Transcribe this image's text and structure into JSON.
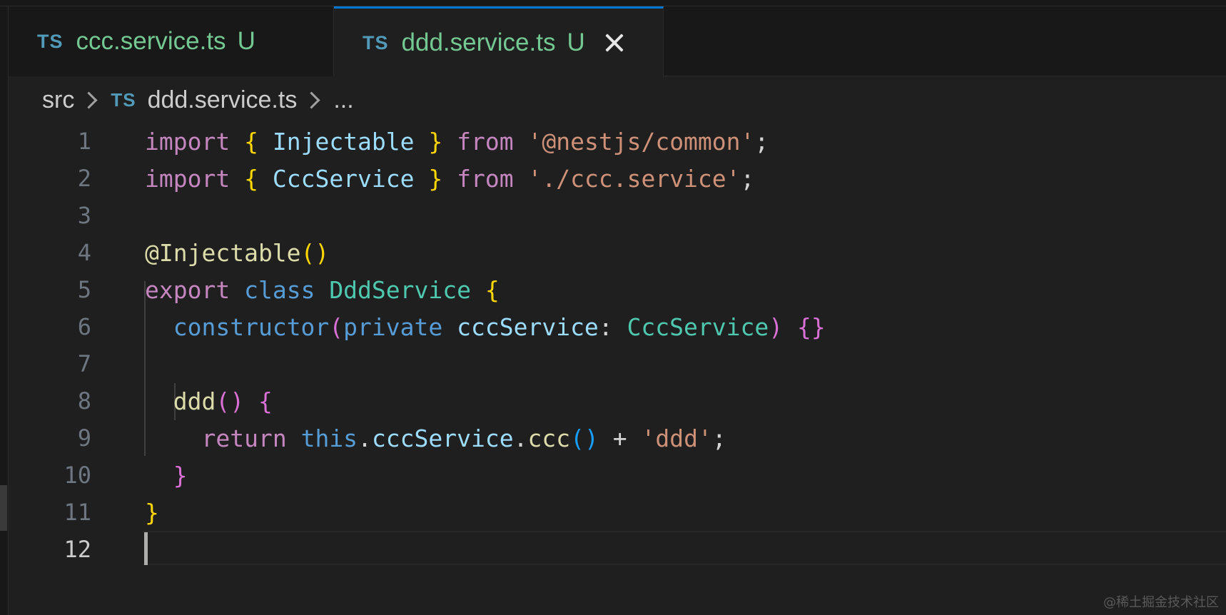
{
  "tabs": [
    {
      "lang_badge": "TS",
      "name": "ccc.service.ts",
      "status": "U",
      "active": false
    },
    {
      "lang_badge": "TS",
      "name": "ddd.service.ts",
      "status": "U",
      "active": true
    }
  ],
  "breadcrumb": {
    "folder": "src",
    "lang_badge": "TS",
    "file": "ddd.service.ts",
    "more": "..."
  },
  "editor": {
    "current_line": 12,
    "line_numbers": [
      "1",
      "2",
      "3",
      "4",
      "5",
      "6",
      "7",
      "8",
      "9",
      "10",
      "11",
      "12"
    ],
    "lines": [
      [
        [
          "kw",
          "import"
        ],
        [
          "punc",
          " "
        ],
        [
          "br1",
          "{"
        ],
        [
          "punc",
          " "
        ],
        [
          "ident",
          "Injectable"
        ],
        [
          "punc",
          " "
        ],
        [
          "br1",
          "}"
        ],
        [
          "punc",
          " "
        ],
        [
          "kw",
          "from"
        ],
        [
          "punc",
          " "
        ],
        [
          "str",
          "'@nestjs/common'"
        ],
        [
          "punc",
          ";"
        ]
      ],
      [
        [
          "kw",
          "import"
        ],
        [
          "punc",
          " "
        ],
        [
          "br1",
          "{"
        ],
        [
          "punc",
          " "
        ],
        [
          "ident",
          "CccService"
        ],
        [
          "punc",
          " "
        ],
        [
          "br1",
          "}"
        ],
        [
          "punc",
          " "
        ],
        [
          "kw",
          "from"
        ],
        [
          "punc",
          " "
        ],
        [
          "str",
          "'./ccc.service'"
        ],
        [
          "punc",
          ";"
        ]
      ],
      [],
      [
        [
          "func",
          "@Injectable"
        ],
        [
          "br1",
          "()"
        ]
      ],
      [
        [
          "kw",
          "export"
        ],
        [
          "punc",
          " "
        ],
        [
          "kw2",
          "class"
        ],
        [
          "punc",
          " "
        ],
        [
          "cls",
          "DddService"
        ],
        [
          "punc",
          " "
        ],
        [
          "br1",
          "{"
        ]
      ],
      [
        [
          "punc",
          "  "
        ],
        [
          "kw2",
          "constructor"
        ],
        [
          "br2",
          "("
        ],
        [
          "kw2",
          "private"
        ],
        [
          "punc",
          " "
        ],
        [
          "ident",
          "cccService"
        ],
        [
          "punc",
          ": "
        ],
        [
          "cls",
          "CccService"
        ],
        [
          "br2",
          ")"
        ],
        [
          "punc",
          " "
        ],
        [
          "br2",
          "{}"
        ]
      ],
      [],
      [
        [
          "punc",
          "  "
        ],
        [
          "func",
          "ddd"
        ],
        [
          "br2",
          "()"
        ],
        [
          "punc",
          " "
        ],
        [
          "br2",
          "{"
        ]
      ],
      [
        [
          "punc",
          "    "
        ],
        [
          "kw",
          "return"
        ],
        [
          "punc",
          " "
        ],
        [
          "kw2",
          "this"
        ],
        [
          "punc",
          "."
        ],
        [
          "ident",
          "cccService"
        ],
        [
          "punc",
          "."
        ],
        [
          "func",
          "ccc"
        ],
        [
          "br3",
          "()"
        ],
        [
          "punc",
          " + "
        ],
        [
          "str",
          "'ddd'"
        ],
        [
          "punc",
          ";"
        ]
      ],
      [
        [
          "punc",
          "  "
        ],
        [
          "br2",
          "}"
        ]
      ],
      [
        [
          "br1",
          "}"
        ]
      ],
      []
    ]
  },
  "watermark": "@稀土掘金技术社区"
}
